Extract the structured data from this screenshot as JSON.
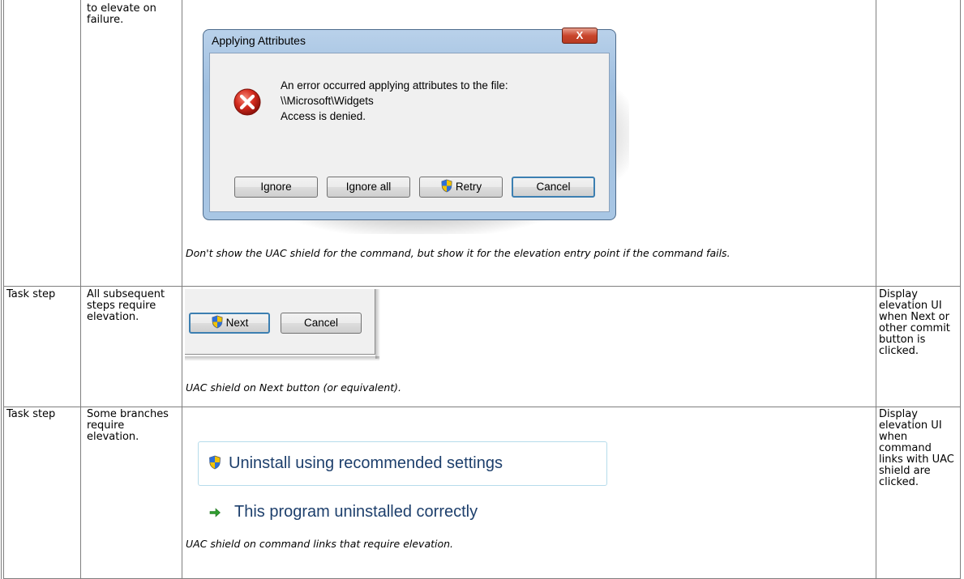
{
  "row_top": {
    "requirement": "to elevate on failure.",
    "caption": "Don't show the UAC shield for the command, but show it for the elevation entry point if the command fails."
  },
  "dialog": {
    "title": "Applying Attributes",
    "close_label": "X",
    "message_line1": "An error occurred applying attributes to the file:",
    "message_line2": "\\\\Microsoft\\Widgets",
    "message_line3": "Access is denied.",
    "buttons": {
      "ignore": "Ignore",
      "ignore_all": "Ignore all",
      "retry": "Retry",
      "cancel": "Cancel"
    },
    "error_icon": "error-x-icon",
    "shield_icon": "uac-shield-icon"
  },
  "row_task_all": {
    "type": "Task step",
    "requirement": "All subsequent steps require elevation.",
    "next_label": "Next",
    "cancel_label": "Cancel",
    "caption": "UAC shield on Next button (or equivalent).",
    "behavior": "Display elevation UI when Next or other commit button is clicked."
  },
  "row_task_some": {
    "type": "Task step",
    "requirement": "Some branches require elevation.",
    "link_elevated": "Uninstall using recommended settings",
    "link_normal": "This program uninstalled correctly",
    "caption": "UAC shield on command links that require elevation.",
    "behavior": "Display elevation UI when command links with UAC shield are clicked."
  }
}
